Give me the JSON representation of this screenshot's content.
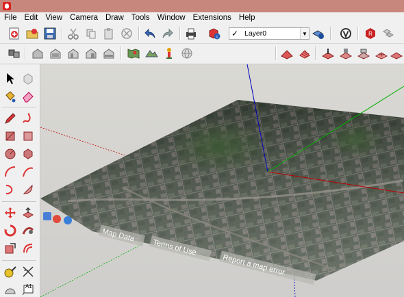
{
  "menubar": {
    "items": [
      {
        "label": "File"
      },
      {
        "label": "Edit"
      },
      {
        "label": "View"
      },
      {
        "label": "Camera"
      },
      {
        "label": "Draw"
      },
      {
        "label": "Tools"
      },
      {
        "label": "Window"
      },
      {
        "label": "Extensions"
      },
      {
        "label": "Help"
      }
    ]
  },
  "layer": {
    "current": "Layer0"
  },
  "map_overlay": {
    "map_data": "Map Data",
    "terms": "Terms of Use",
    "report": "Report a map error"
  },
  "left_toolbar": {
    "text_tool_label": "A1"
  },
  "colors": {
    "titlebar": "#c7877c",
    "axis_red": "#c00000",
    "axis_green": "#00b000",
    "axis_blue": "#0000c0",
    "sky": "#d7d6d1"
  }
}
